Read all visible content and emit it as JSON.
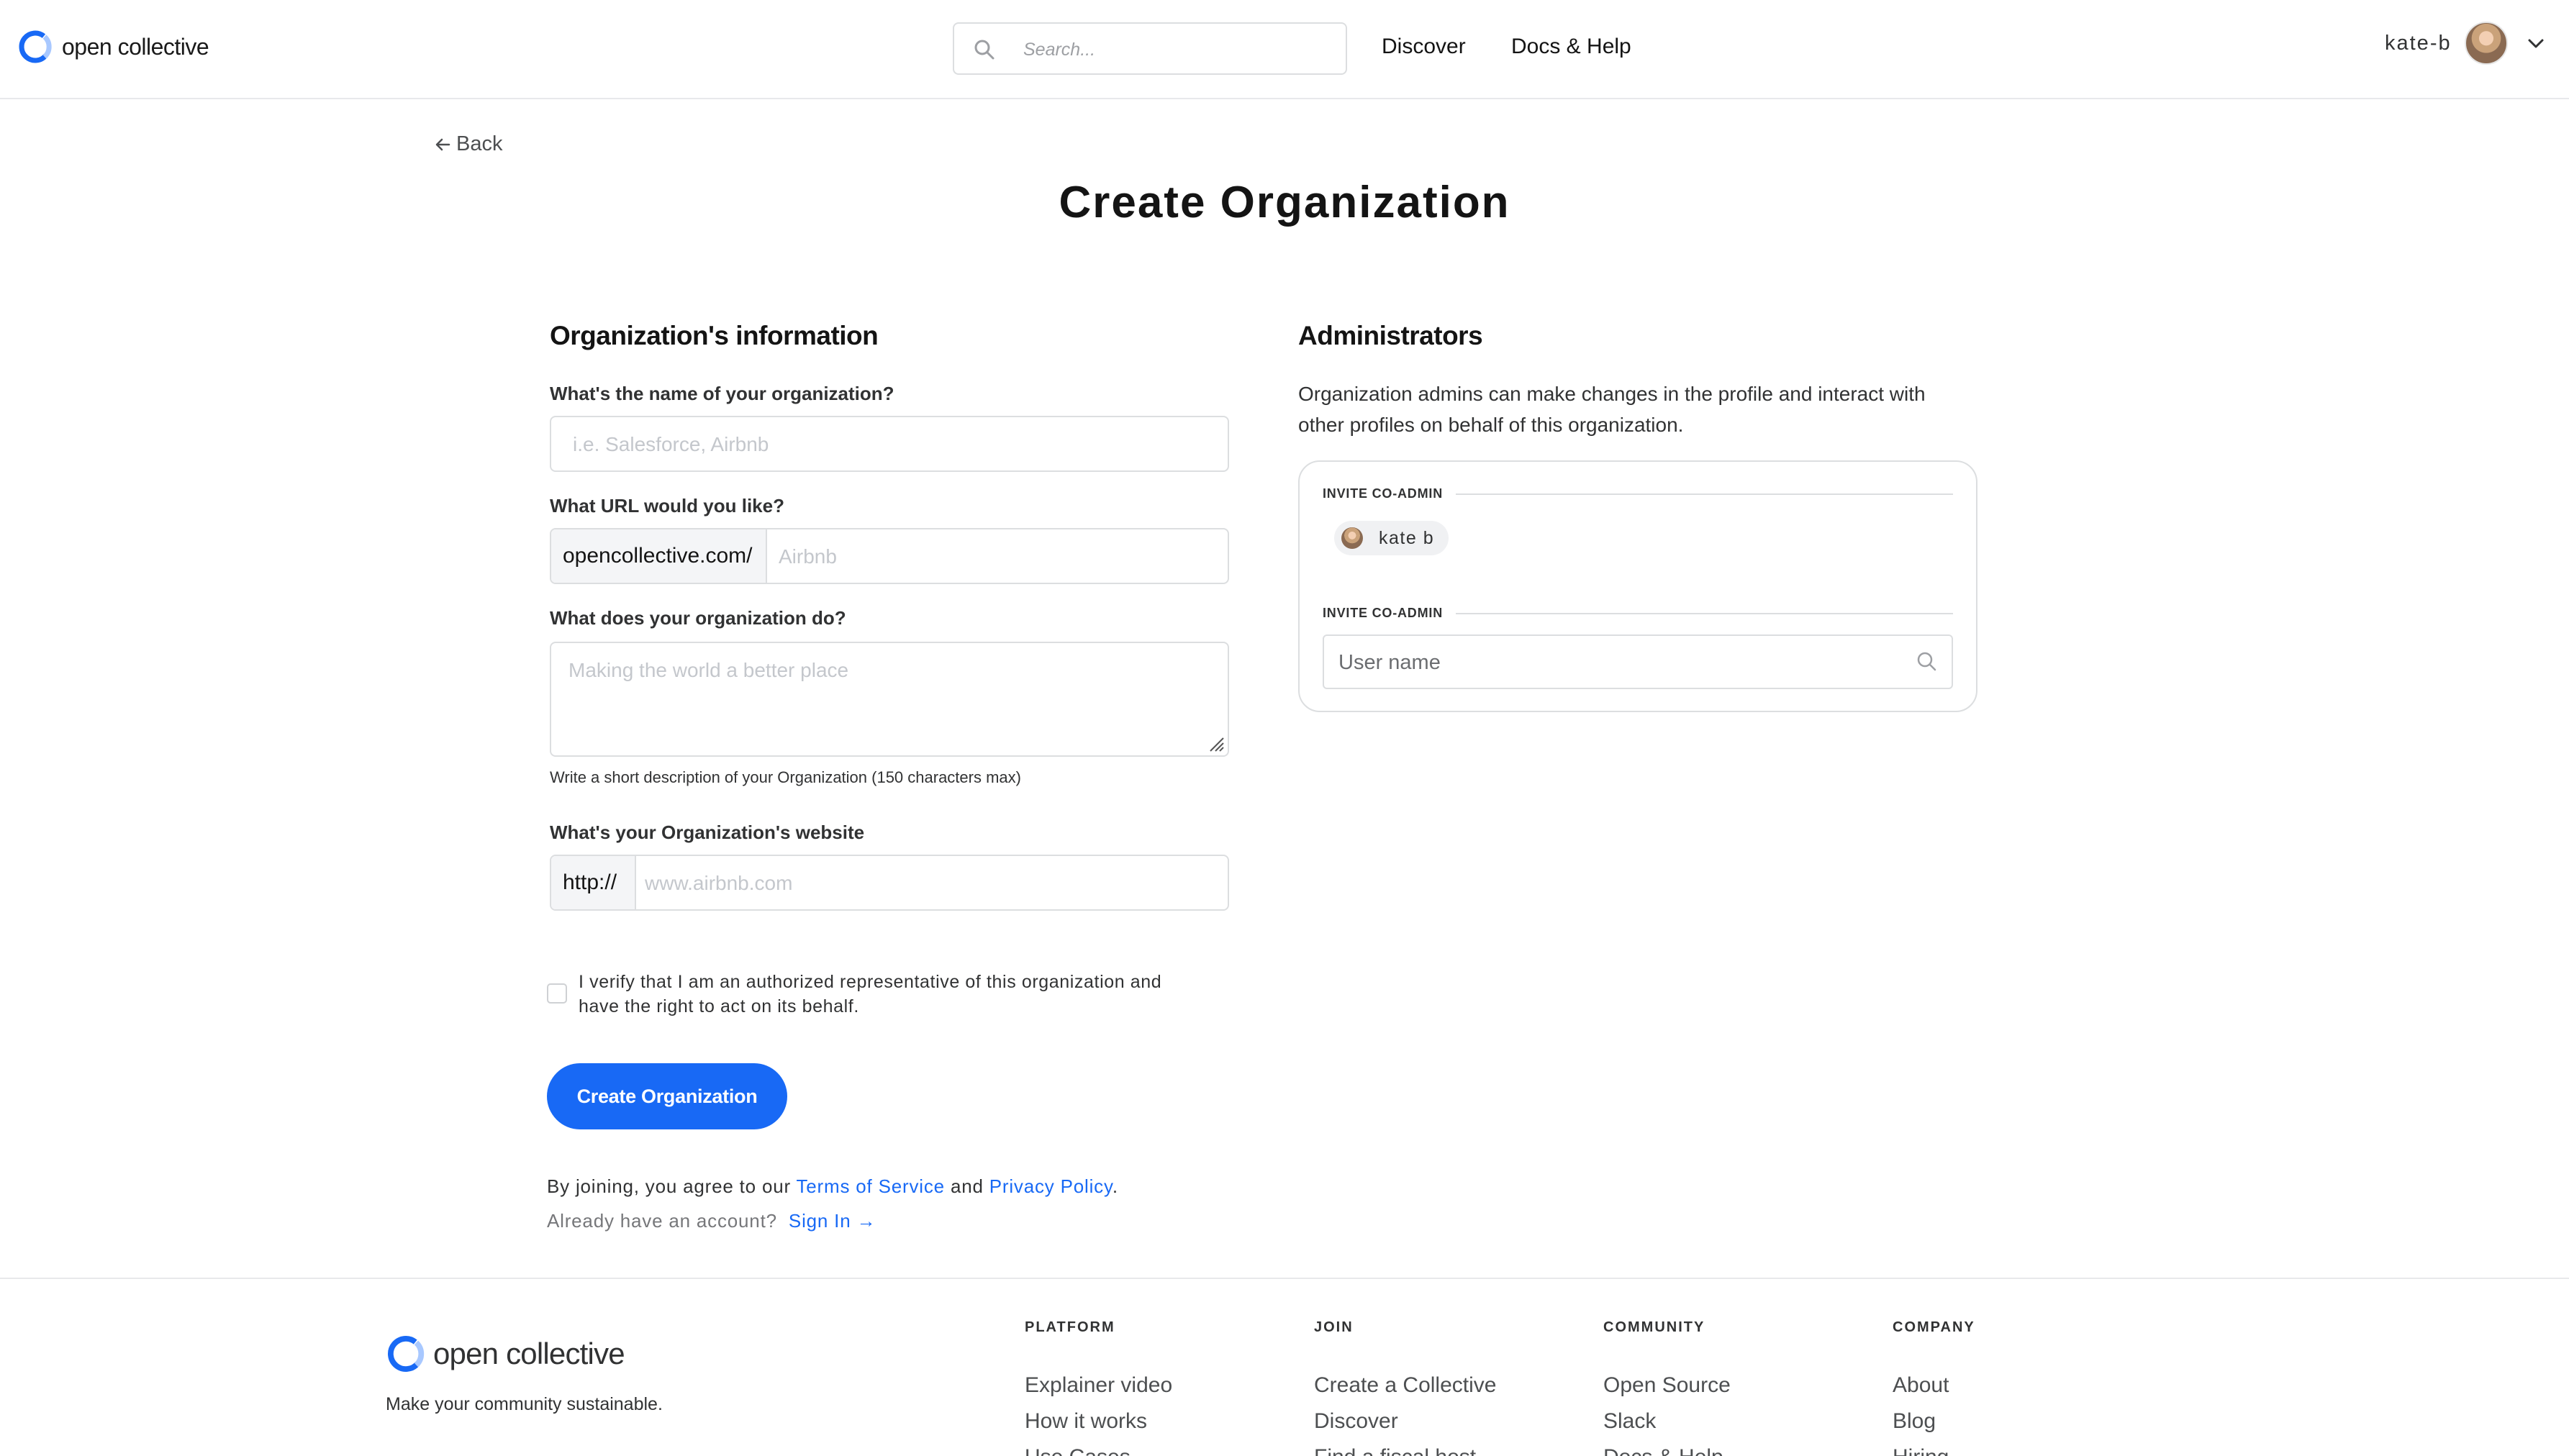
{
  "header": {
    "logo_text": "open collective",
    "search_placeholder": "Search...",
    "nav": {
      "discover": "Discover",
      "docs": "Docs & Help"
    },
    "user_name": "kate-b"
  },
  "main": {
    "back_label": "Back",
    "page_title": "Create Organization",
    "org_section": {
      "title": "Organization's information",
      "name_label": "What's the name of your organization?",
      "name_placeholder": "i.e. Salesforce, Airbnb",
      "url_label": "What URL would you like?",
      "url_prefix": "opencollective.com/",
      "url_placeholder": "Airbnb",
      "description_label": "What does your organization do?",
      "description_placeholder": "Making the world a better place",
      "description_help": "Write a short description of your Organization (150 characters max)",
      "website_label": "What's your Organization's website",
      "website_prefix": "http://",
      "website_placeholder": "www.airbnb.com",
      "verify_text": "I verify that I am an authorized representative of this organization and have the right to act on its behalf.",
      "verify_checked": false,
      "submit_label": "Create Organization",
      "terms_prefix": "By joining, you agree to our",
      "terms_link": "Terms of Service",
      "terms_and": "and",
      "privacy_link": "Privacy Policy",
      "terms_suffix": ".",
      "account_question": "Already have an account?",
      "signin_link": "Sign In →"
    },
    "admin_section": {
      "title": "Administrators",
      "description": "Organization admins can make changes in the profile and interact with other profiles on behalf of this organization.",
      "invite_label_1": "INVITE CO-ADMIN",
      "admin_chip": "kate b",
      "invite_label_2": "INVITE CO-ADMIN",
      "user_search_placeholder": "User name"
    }
  },
  "footer": {
    "logo_text": "open collective",
    "tagline": "Make your community sustainable.",
    "columns": [
      {
        "title": "PLATFORM",
        "links": [
          "Explainer video",
          "How it works",
          "Use Cases"
        ]
      },
      {
        "title": "JOIN",
        "links": [
          "Create a Collective",
          "Discover",
          "Find a fiscal host"
        ]
      },
      {
        "title": "COMMUNITY",
        "links": [
          "Open Source",
          "Slack",
          "Docs & Help"
        ]
      },
      {
        "title": "COMPANY",
        "links": [
          "About",
          "Blog",
          "Hiring"
        ]
      }
    ]
  },
  "colors": {
    "brand_blue": "#1869f5",
    "border": "#dcdee0",
    "text": "#141414"
  },
  "icons": [
    "logo-icon",
    "search-icon",
    "chevron-down-icon",
    "arrow-left-icon",
    "resize-handle-icon"
  ]
}
